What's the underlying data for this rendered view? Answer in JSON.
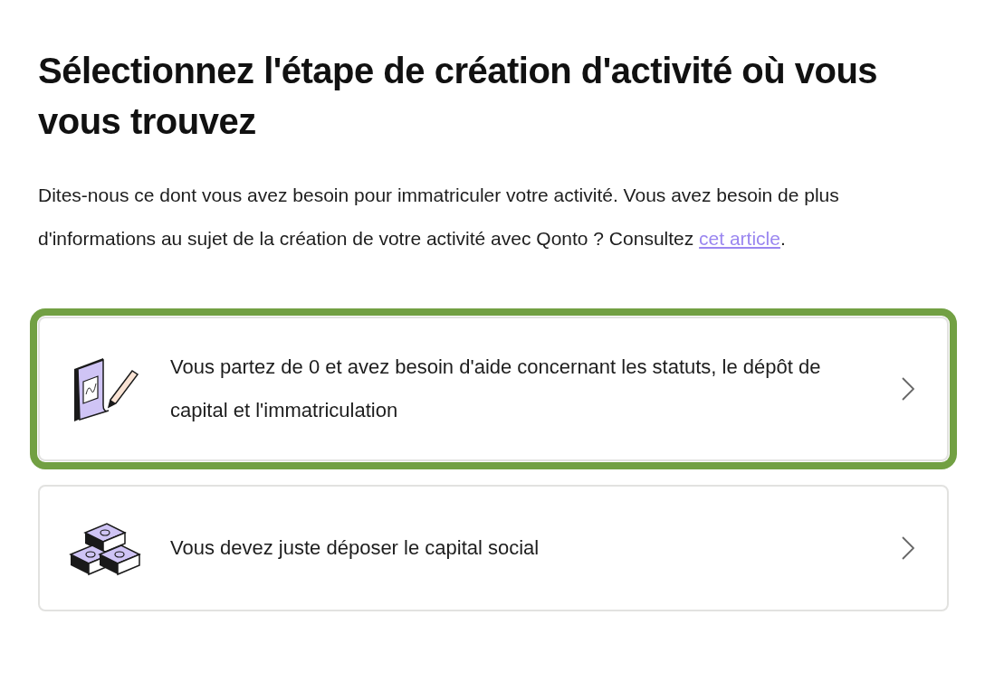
{
  "title": "Sélectionnez l'étape de création d'activité où vous vous trouvez",
  "intro": {
    "before": "Dites-nous ce dont vous avez besoin pour immatriculer votre activité. Vous avez besoin de plus d'informations au sujet de la création de votre activité avec Qonto ? Consultez ",
    "link": "cet article",
    "after": "."
  },
  "options": [
    {
      "kind": "document",
      "label": "Vous partez de 0 et avez besoin d'aide concernant les statuts, le dépôt de capital et l'immatriculation",
      "selected": true
    },
    {
      "kind": "money",
      "label": "Vous devez juste déposer le capital social",
      "selected": false
    }
  ]
}
